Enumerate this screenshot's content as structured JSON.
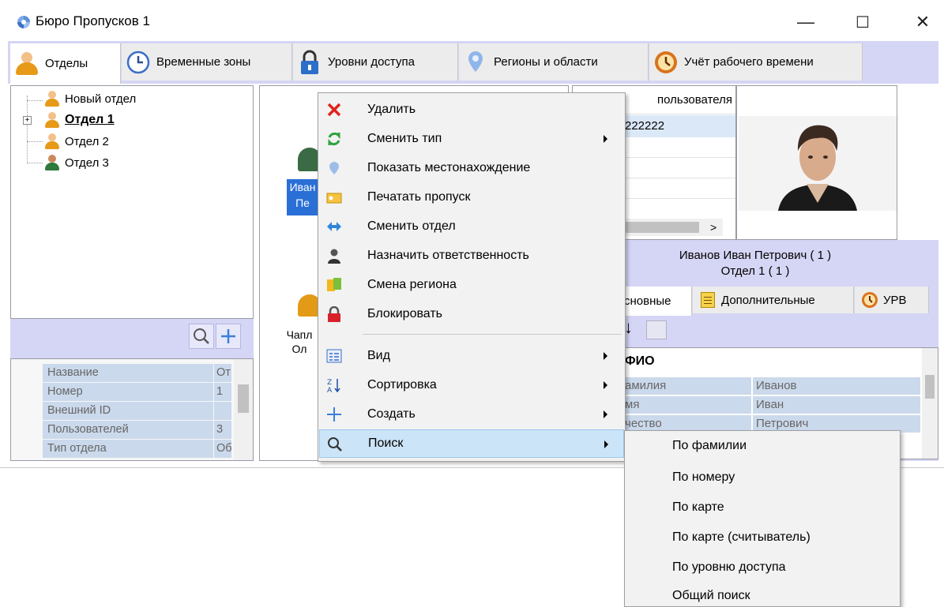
{
  "window": {
    "title": "Бюро Пропусков 1",
    "minimize": "—",
    "maximize": "☐",
    "close": "✕"
  },
  "tabs": [
    {
      "label": "Отделы",
      "icon": "person-icon",
      "active": true
    },
    {
      "label": "Временные зоны",
      "icon": "clock-icon"
    },
    {
      "label": "Уровни доступа",
      "icon": "padlock-icon"
    },
    {
      "label": "Регионы и области",
      "icon": "location-pin-icon"
    },
    {
      "label": "Учёт рабочего времени",
      "icon": "time-tracking-icon"
    }
  ],
  "tree": [
    {
      "label": "Новый отдел",
      "bold": false
    },
    {
      "label": "Отдел 1",
      "bold": true,
      "expander": "+"
    },
    {
      "label": "Отдел 2",
      "bold": false
    },
    {
      "label": "Отдел 3",
      "bold": false
    }
  ],
  "properties": [
    {
      "key": "Название",
      "value": "От"
    },
    {
      "key": "Номер",
      "value": "1"
    },
    {
      "key": "Внешний ID",
      "value": ""
    },
    {
      "key": "Пользователей",
      "value": "3"
    },
    {
      "key": "Тип отдела",
      "value": "Об"
    }
  ],
  "middle": {
    "user1_line1": "Иван",
    "user1_line2": "Пе",
    "user2_line1": "Чапл",
    "user2_line2": "Ол"
  },
  "grid": {
    "header": "пользователя",
    "cell": "222222",
    "scroll_right": ">"
  },
  "person": {
    "name": "Иванов Иван Петрович ( 1 )",
    "department": "Отдел 1 ( 1 )"
  },
  "right_tabs": [
    {
      "label": "сновные"
    },
    {
      "label": "Дополнительные",
      "icon": "notes-icon"
    },
    {
      "label": "УРВ",
      "icon": "time-tracking-icon"
    }
  ],
  "detail": {
    "group": "ФИО",
    "rows": [
      {
        "key": "амилия",
        "value": "Иванов"
      },
      {
        "key": "мя",
        "value": "Иван"
      },
      {
        "key": "чество",
        "value": "Петрович"
      }
    ]
  },
  "context_menu": [
    {
      "label": "Удалить",
      "icon": "delete-x-icon",
      "submenu": false
    },
    {
      "label": "Сменить тип",
      "icon": "swap-arrows-icon",
      "submenu": true
    },
    {
      "label": "Показать местонахождение",
      "icon": "location-pin-icon",
      "submenu": false
    },
    {
      "label": "Печатать пропуск",
      "icon": "print-badge-icon",
      "submenu": false
    },
    {
      "label": "Сменить отдел",
      "icon": "move-arrows-icon",
      "submenu": false
    },
    {
      "label": "Назначить ответственность",
      "icon": "responsible-person-icon",
      "submenu": false
    },
    {
      "label": "Смена региона",
      "icon": "region-change-icon",
      "submenu": false
    },
    {
      "label": "Блокировать",
      "icon": "lock-icon",
      "submenu": false
    },
    {
      "label": "Вид",
      "icon": "view-icon",
      "submenu": true
    },
    {
      "label": "Сортировка",
      "icon": "sort-az-icon",
      "submenu": true
    },
    {
      "label": "Создать",
      "icon": "plus-icon",
      "submenu": true
    },
    {
      "label": "Поиск",
      "icon": "search-icon",
      "submenu": true,
      "highlighted": true
    }
  ],
  "search_submenu": [
    "По фамилии",
    "По номеру",
    "По карте",
    "По карте (считыватель)",
    "По уровню доступа",
    "Общий поиск"
  ]
}
